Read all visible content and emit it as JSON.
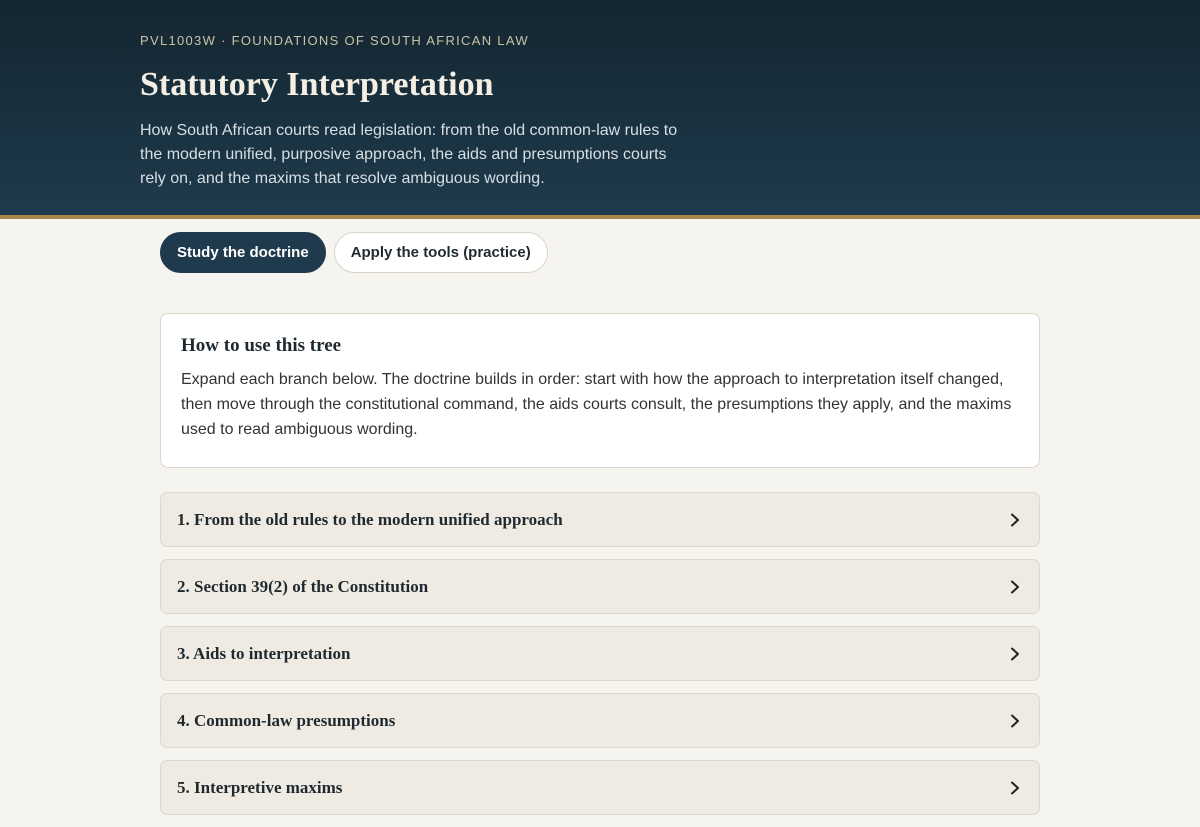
{
  "header": {
    "course": "PVL1003W · FOUNDATIONS OF SOUTH AFRICAN LAW",
    "title": "Statutory Interpretation",
    "subtitle": "How South African courts read legislation: from the old common-law rules to the modern unified, purposive approach, the aids and presumptions courts rely on, and the maxims that resolve ambiguous wording."
  },
  "tabs": [
    {
      "label": "Study the doctrine",
      "active": true
    },
    {
      "label": "Apply the tools (practice)",
      "active": false
    }
  ],
  "info": {
    "title": "How to use this tree",
    "text": "Expand each branch below. The doctrine builds in order: start with how the approach to interpretation itself changed, then move through the constitutional command, the aids courts consult, the presumptions they apply, and the maxims used to read ambiguous wording."
  },
  "branches": [
    {
      "label": "1. From the old rules to the modern unified approach",
      "icon": "chevron-right-icon"
    },
    {
      "label": "2. Section 39(2) of the Constitution",
      "icon": "chevron-right-icon"
    },
    {
      "label": "3. Aids to interpretation",
      "icon": "chevron-right-icon"
    },
    {
      "label": "4. Common-law presumptions",
      "icon": "chevron-right-icon"
    },
    {
      "label": "5. Interpretive maxims",
      "icon": "chevron-right-icon"
    }
  ],
  "colors": {
    "header_bg": "#1e3a4c",
    "accent_rule": "#a8874a",
    "page_bg": "#f6f4ee"
  }
}
